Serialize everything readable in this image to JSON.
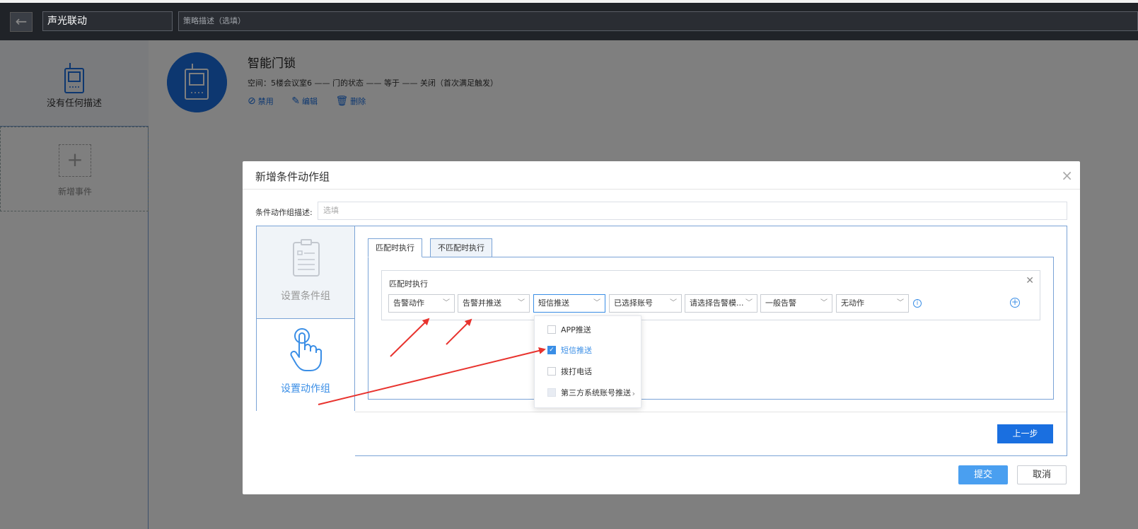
{
  "topbar": {
    "back_icon": "arrow-left-icon",
    "name_value": "声光联动",
    "desc_placeholder": "策略描述（选填）"
  },
  "sidebar": {
    "device_label": "没有任何描述",
    "add_event_label": "新增事件"
  },
  "device": {
    "title": "智能门锁",
    "info": "空间：5楼会议室6 —— 门的状态 —— 等于 —— 关闭（首次满足触发）",
    "actions": [
      {
        "label": "禁用",
        "icon": "ban-icon"
      },
      {
        "label": "编辑",
        "icon": "edit-icon"
      },
      {
        "label": "删除",
        "icon": "trash-icon"
      }
    ]
  },
  "modal": {
    "title": "新增条件动作组",
    "desc_label": "条件动作组描述:",
    "desc_placeholder": "选填",
    "steps": [
      {
        "label": "设置条件组",
        "icon": "clipboard-icon",
        "active": false
      },
      {
        "label": "设置动作组",
        "icon": "pointer-hand-icon",
        "active": true
      }
    ],
    "tabs": [
      {
        "label": "匹配时执行",
        "active": true
      },
      {
        "label": "不匹配时执行",
        "active": false
      }
    ],
    "rule": {
      "title": "匹配时执行",
      "selects": [
        "告警动作",
        "告警并推送",
        "短信推送",
        "已选择账号",
        "请选择告警模...",
        "一般告警",
        "无动作"
      ]
    },
    "prev_label": "上一步",
    "submit_label": "提交",
    "cancel_label": "取消"
  },
  "dropdown": {
    "items": [
      {
        "label": "APP推送",
        "checked": false
      },
      {
        "label": "短信推送",
        "checked": true
      },
      {
        "label": "拨打电话",
        "checked": false
      },
      {
        "label": "第三方系统账号推送",
        "checked": false,
        "has_submenu": true
      }
    ]
  },
  "colors": {
    "accent": "#1a6fe0",
    "annotation_arrow": "#e8332e"
  }
}
